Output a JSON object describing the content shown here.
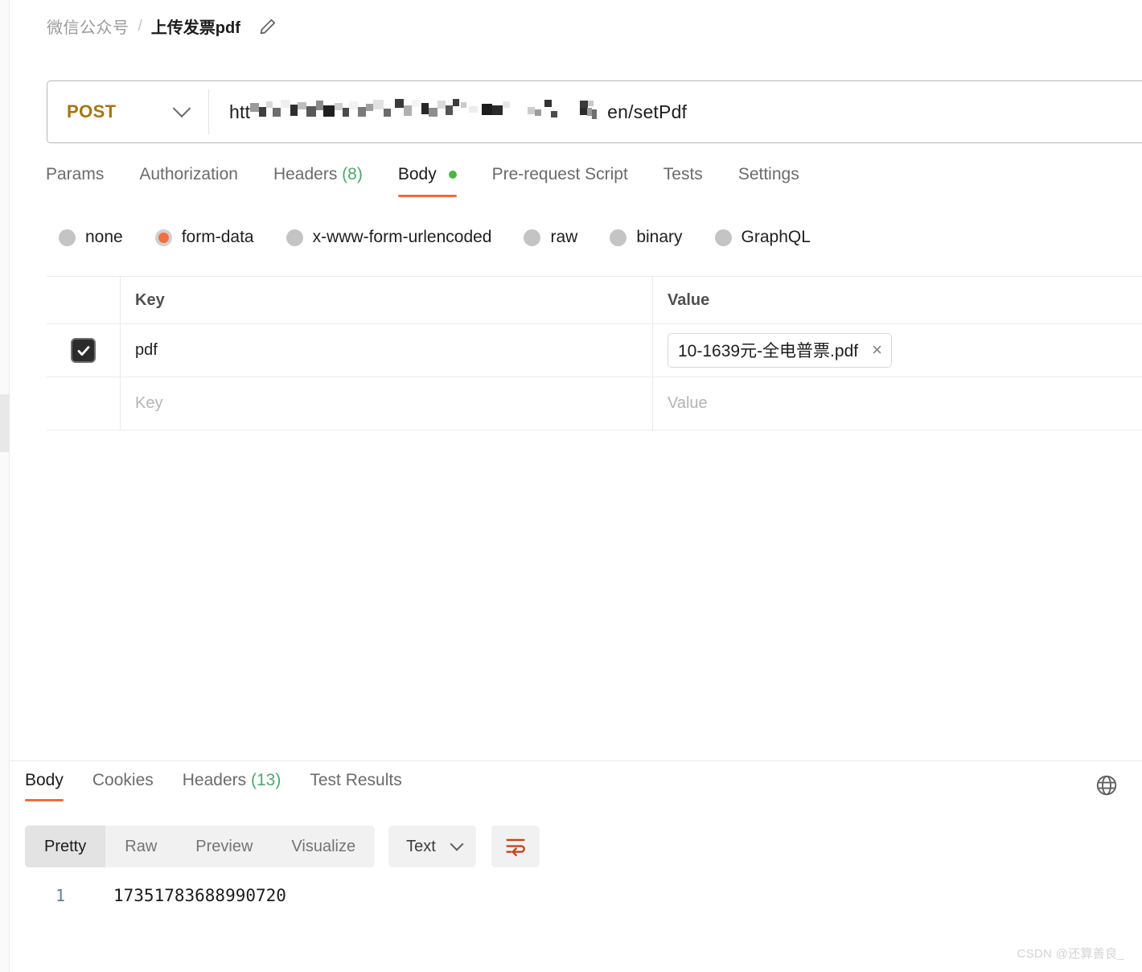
{
  "breadcrumb": {
    "folder": "微信公众号",
    "separator": "/",
    "name": "上传发票pdf",
    "edit_icon": "pencil-icon"
  },
  "url_bar": {
    "method": "POST",
    "method_color": "#a8740f",
    "url_prefix": "htt",
    "url_redacted": true,
    "url_suffix": "en/setPdf"
  },
  "request_tabs": {
    "items": [
      {
        "label": "Params",
        "count": "",
        "active": false,
        "dot": false
      },
      {
        "label": "Authorization",
        "count": "",
        "active": false,
        "dot": false
      },
      {
        "label": "Headers",
        "count": "(8)",
        "active": false,
        "dot": false
      },
      {
        "label": "Body",
        "count": "",
        "active": true,
        "dot": true
      },
      {
        "label": "Pre-request Script",
        "count": "",
        "active": false,
        "dot": false
      },
      {
        "label": "Tests",
        "count": "",
        "active": false,
        "dot": false
      },
      {
        "label": "Settings",
        "count": "",
        "active": false,
        "dot": false
      }
    ],
    "active_underline_color": "#f26b3a",
    "count_color": "#4aa96c",
    "dot_color": "#4bb543"
  },
  "body_types": {
    "selected": "form-data",
    "selected_color": "#f2703f",
    "options": [
      {
        "label": "none",
        "selected": false
      },
      {
        "label": "form-data",
        "selected": true
      },
      {
        "label": "x-www-form-urlencoded",
        "selected": false
      },
      {
        "label": "raw",
        "selected": false
      },
      {
        "label": "binary",
        "selected": false
      },
      {
        "label": "GraphQL",
        "selected": false
      }
    ]
  },
  "kv_table": {
    "headers": {
      "key": "Key",
      "value": "Value"
    },
    "rows": [
      {
        "checked": true,
        "key": "pdf",
        "value_chip": "10-1639元-全电普票.pdf",
        "remove_label": "×",
        "is_placeholder": false
      },
      {
        "checked": false,
        "key": "Key",
        "value_chip": "Value",
        "remove_label": "",
        "is_placeholder": true
      }
    ]
  },
  "response": {
    "tabs": [
      {
        "label": "Body",
        "count": "",
        "active": true
      },
      {
        "label": "Cookies",
        "count": "",
        "active": false
      },
      {
        "label": "Headers",
        "count": "(13)",
        "active": false
      },
      {
        "label": "Test Results",
        "count": "",
        "active": false
      }
    ],
    "globe_icon": "globe-icon",
    "view_modes": [
      {
        "label": "Pretty",
        "active": true
      },
      {
        "label": "Raw",
        "active": false
      },
      {
        "label": "Preview",
        "active": false
      },
      {
        "label": "Visualize",
        "active": false
      }
    ],
    "format": "Text",
    "wrap_icon": "wrap-lines-icon",
    "wrap_icon_color": "#c4461f",
    "line_number": "1",
    "body_text": "17351783688990720"
  },
  "watermark": "CSDN @还算善良_"
}
